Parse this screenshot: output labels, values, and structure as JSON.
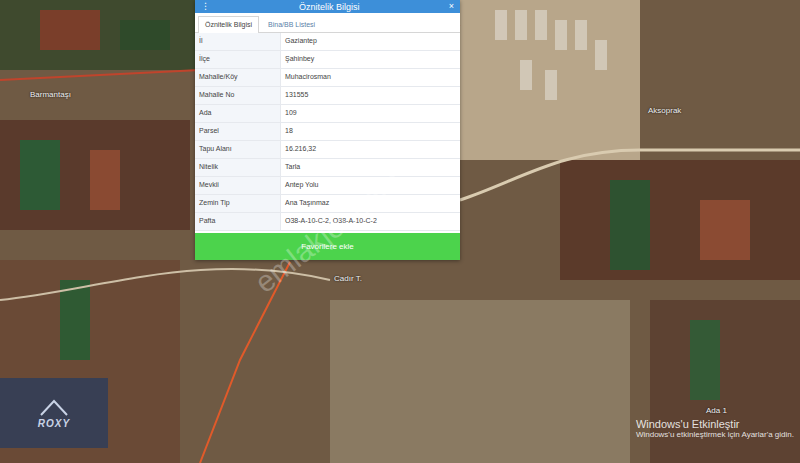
{
  "panel": {
    "title": "Öznitelik Bilgisi",
    "menu_icon": "⋮",
    "close_icon": "×",
    "tabs": [
      {
        "label": "Öznitelik Bilgisi",
        "selected": true
      },
      {
        "label": "Bina/BB Listesi",
        "selected": false
      }
    ],
    "rows": [
      {
        "label": "İl",
        "value": "Gaziantep"
      },
      {
        "label": "İlçe",
        "value": "Şahinbey"
      },
      {
        "label": "Mahalle/Köy",
        "value": "Muhacirosman"
      },
      {
        "label": "Mahalle No",
        "value": "131555"
      },
      {
        "label": "Ada",
        "value": "109"
      },
      {
        "label": "Parsel",
        "value": "18"
      },
      {
        "label": "Tapu Alanı",
        "value": "16.216,32"
      },
      {
        "label": "Nitelik",
        "value": "Tarla"
      },
      {
        "label": "Mevkii",
        "value": "Antep Yolu"
      },
      {
        "label": "Zemin Tip",
        "value": "Ana Taşınmaz"
      },
      {
        "label": "Pafta",
        "value": "O38-A-10-C-2, O38-A-10-C-2"
      }
    ],
    "button": "Favorilere ekle"
  },
  "map": {
    "labels": [
      {
        "text": "Barmantaşı"
      },
      {
        "text": "Aksoprak"
      },
      {
        "text": "Cadır T."
      },
      {
        "text": "Ada 1"
      }
    ]
  },
  "watermark": "emlakjet.com",
  "logo": "ROXY",
  "activation": {
    "title": "Windows'u Etkinleştir",
    "subtitle": "Windows'u etkinleştirmek için Ayarlar'a gidin."
  }
}
